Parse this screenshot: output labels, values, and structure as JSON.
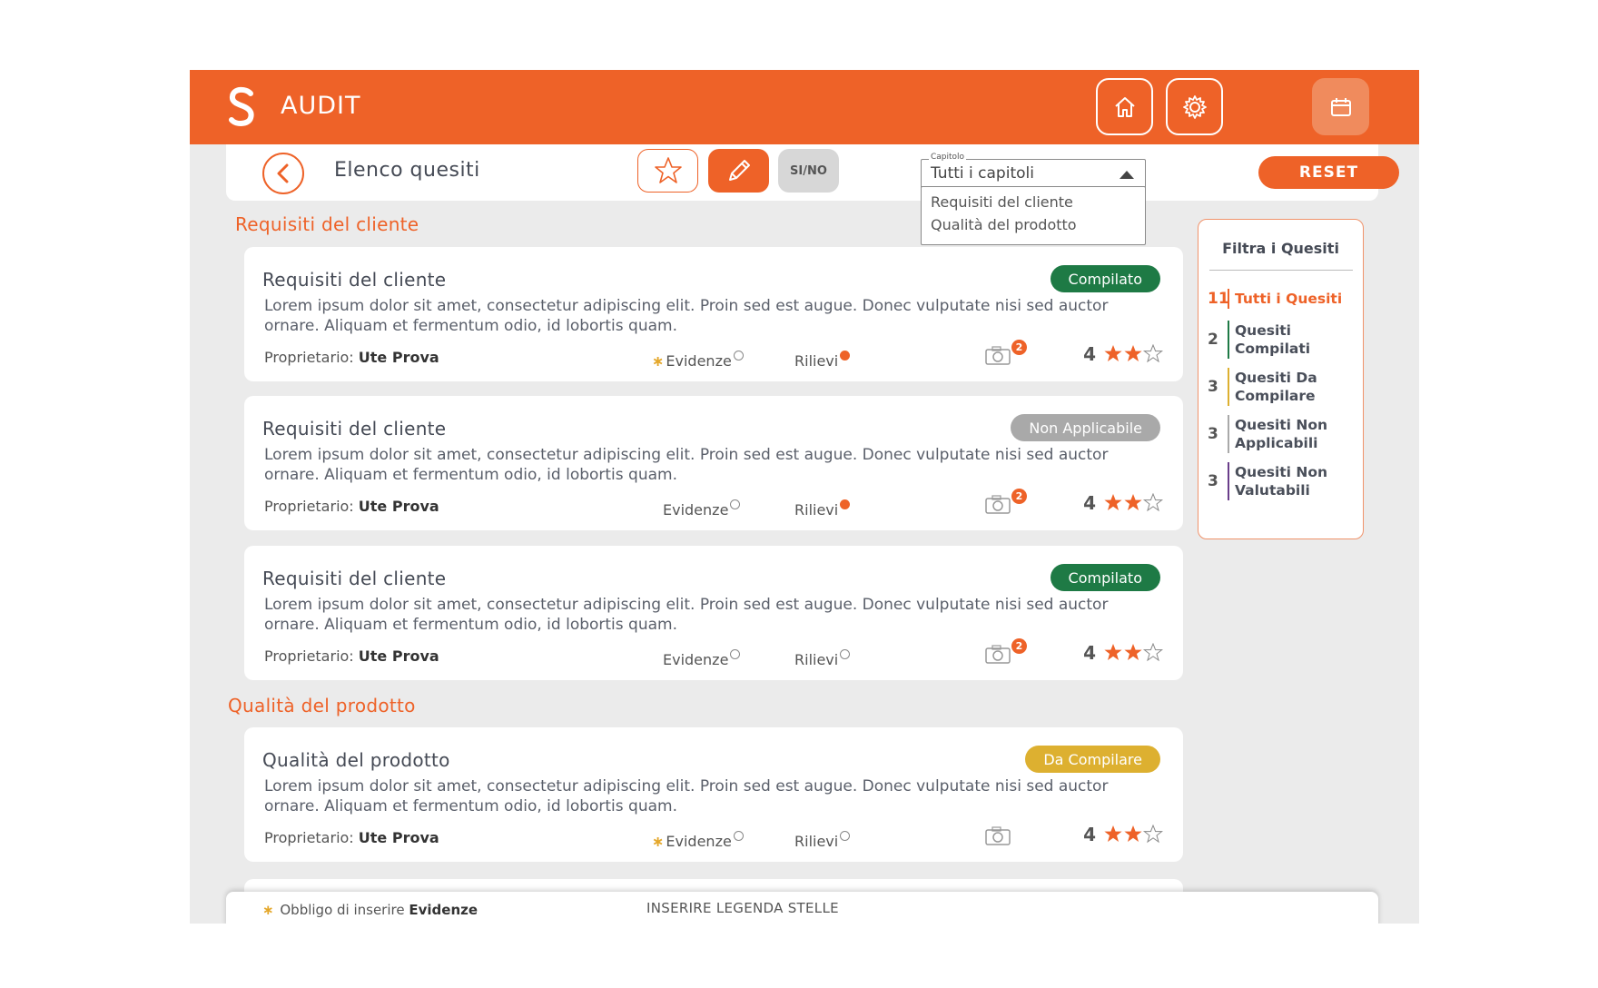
{
  "app": {
    "title": "AUDIT",
    "accent": "#ee6228"
  },
  "header": {
    "icons": [
      "home-icon",
      "gear-icon",
      "calendar-icon"
    ]
  },
  "subbar": {
    "title": "Elenco quesiti",
    "sino_label": "SI/NO",
    "select_label": "Capitolo",
    "select_value": "Tutti i capitoli",
    "dropdown_options": [
      "Requisiti del cliente",
      "Qualità del prodotto"
    ],
    "reset_label": "RESET"
  },
  "sections": [
    {
      "title": "Requisiti del cliente"
    },
    {
      "title": "Qualità del prodotto"
    }
  ],
  "cards": [
    {
      "title": "Requisiti del cliente",
      "status": "Compilato",
      "status_color": "#1e7a45",
      "desc": "Lorem ipsum dolor sit amet, consectetur adipiscing elit. Proin sed est augue. Donec vulputate nisi sed auctor ornare. Aliquam et fermentum odio, id lobortis quam.",
      "owner_label": "Proprietario:",
      "owner": "Ute Prova",
      "evidenze_label": "Evidenze",
      "evidenze_required": true,
      "rilievi_label": "Rilievi",
      "rilievi_flag": true,
      "photo_count": "2",
      "rating": "4",
      "stars": 2
    },
    {
      "title": "Requisiti del cliente",
      "status": "Non Applicabile",
      "status_color": "#a9a9a9",
      "desc": "Lorem ipsum dolor sit amet, consectetur adipiscing elit. Proin sed est augue. Donec vulputate nisi sed auctor ornare. Aliquam et fermentum odio, id lobortis quam.",
      "owner_label": "Proprietario:",
      "owner": "Ute Prova",
      "evidenze_label": "Evidenze",
      "evidenze_required": false,
      "rilievi_label": "Rilievi",
      "rilievi_flag": true,
      "photo_count": "2",
      "rating": "4",
      "stars": 2
    },
    {
      "title": "Requisiti del cliente",
      "status": "Compilato",
      "status_color": "#1e7a45",
      "desc": "Lorem ipsum dolor sit amet, consectetur adipiscing elit. Proin sed est augue. Donec vulputate nisi sed auctor ornare. Aliquam et fermentum odio, id lobortis quam.",
      "owner_label": "Proprietario:",
      "owner": "Ute Prova",
      "evidenze_label": "Evidenze",
      "evidenze_required": false,
      "rilievi_label": "Rilievi",
      "rilievi_flag": false,
      "photo_count": "2",
      "rating": "4",
      "stars": 2
    },
    {
      "title": "Qualità del prodotto",
      "status": "Da Compilare",
      "status_color": "#ddb030",
      "desc": "Lorem ipsum dolor sit amet, consectetur adipiscing elit. Proin sed est augue. Donec vulputate nisi sed auctor ornare. Aliquam et fermentum odio, id lobortis quam.",
      "owner_label": "Proprietario:",
      "owner": "Ute Prova",
      "evidenze_label": "Evidenze",
      "evidenze_required": true,
      "rilievi_label": "Rilievi",
      "rilievi_flag": false,
      "photo_count": "",
      "rating": "4",
      "stars": 2
    }
  ],
  "filter": {
    "title": "Filtra i Quesiti",
    "items": [
      {
        "count": "11",
        "label": "Tutti i Quesiti",
        "color": "#ee6228",
        "active": true
      },
      {
        "count": "2",
        "label": "Quesiti Compilati",
        "color": "#1e7a45"
      },
      {
        "count": "3",
        "label": "Quesiti Da Compilare",
        "color": "#ddb030"
      },
      {
        "count": "3",
        "label": "Quesiti Non Applicabili",
        "color": "#a9a9a9"
      },
      {
        "count": "3",
        "label": "Quesiti Non Valutabili",
        "color": "#6a3d8a"
      }
    ]
  },
  "footer": {
    "note_prefix": "Obbligo di inserire",
    "note_bold": "Evidenze",
    "legend": "INSERIRE LEGENDA STELLE"
  }
}
